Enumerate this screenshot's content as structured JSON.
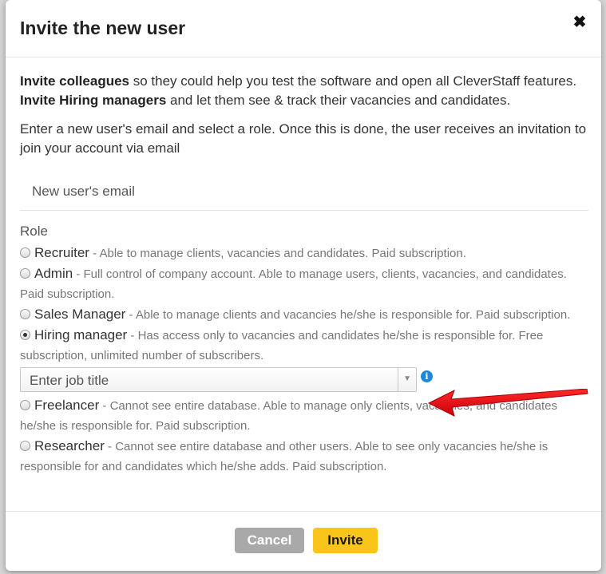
{
  "modal": {
    "title": "Invite the new user",
    "close_glyph": "✖"
  },
  "intro": {
    "line1_bold": "Invite colleagues",
    "line1_rest": " so they could help you test the software and open all CleverStaff features.",
    "line2_bold": "Invite Hiring managers",
    "line2_rest": " and let them see & track their vacancies and candidates."
  },
  "instructions": "Enter a new user's email and select a role. Once this is done, the user receives an invitation to join your account via email",
  "email": {
    "placeholder": "New user's email",
    "value": ""
  },
  "role": {
    "title": "Role",
    "selected": "Hiring manager",
    "options": [
      {
        "name": "Recruiter",
        "desc": " - Able to manage clients, vacancies and candidates. Paid subscription."
      },
      {
        "name": "Admin",
        "desc": " - Full control of company account. Able to manage users, clients, vacancies, and candidates. Paid subscription."
      },
      {
        "name": "Sales Manager",
        "desc": " - Able to manage clients and vacancies he/she is responsible for. Paid subscription."
      },
      {
        "name": "Hiring manager",
        "desc": " - Has access only to vacancies and candidates he/she is responsible for. Free subscription, unlimited number of subscribers."
      },
      {
        "name": "Freelancer",
        "desc": " - Cannot see entire database. Able to manage only clients, vacancies, and candidates he/she is responsible for. Paid subscription."
      },
      {
        "name": "Researcher",
        "desc": " - Cannot see entire database and other users. Able to see only vacancies he/she is responsible for and candidates which he/she adds. Paid subscription."
      }
    ]
  },
  "job_title": {
    "placeholder": "Enter job title",
    "caret_glyph": "▼",
    "info_glyph": "i"
  },
  "footer": {
    "cancel_label": "Cancel",
    "invite_label": "Invite"
  },
  "colors": {
    "invite_button": "#f9c51a",
    "cancel_button": "#a9a9a9",
    "info_icon": "#1e88d6",
    "arrow": "#e0141e"
  },
  "icons": {
    "close": "close-icon",
    "info": "info-icon",
    "caret": "chevron-down-icon",
    "annotation": "red-arrow-icon"
  }
}
